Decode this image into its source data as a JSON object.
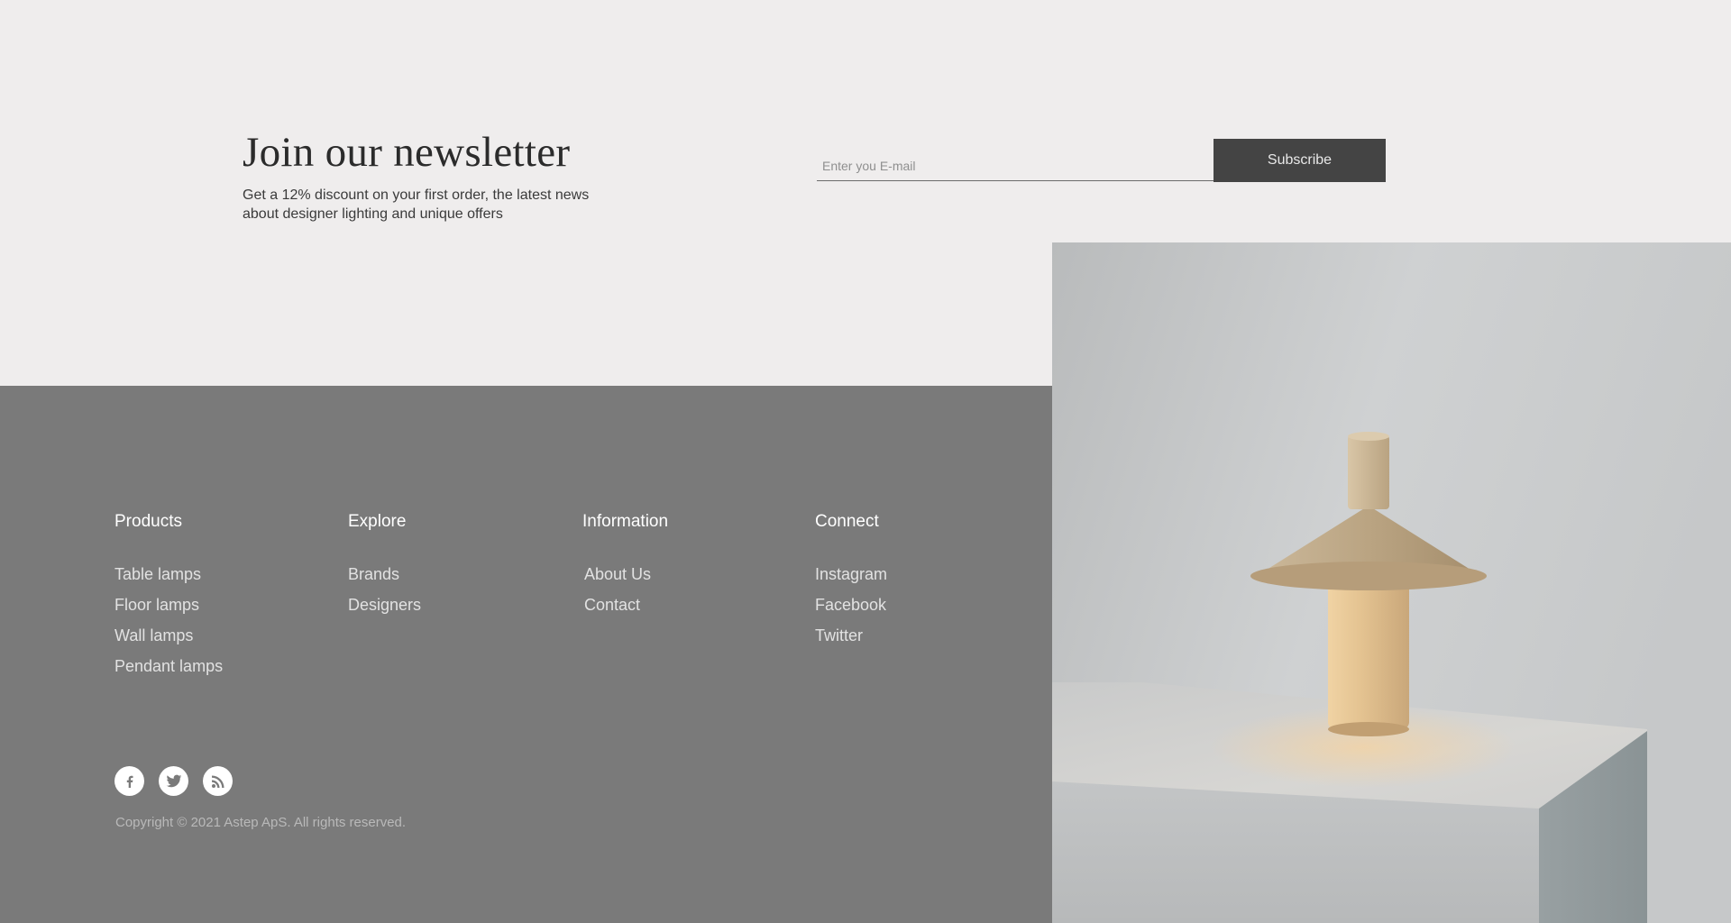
{
  "newsletter": {
    "title": "Join our newsletter",
    "description": "Get a 12% discount on your first order, the latest news about designer lighting and unique offers",
    "email_placeholder": "Enter you E-mail",
    "subscribe_label": "Subscribe"
  },
  "footer": {
    "columns": [
      {
        "heading": "Products",
        "links": [
          "Table lamps",
          "Floor lamps",
          "Wall lamps",
          "Pendant lamps"
        ]
      },
      {
        "heading": "Explore",
        "links": [
          "Brands",
          "Designers"
        ]
      },
      {
        "heading": "Information",
        "links": [
          "About Us",
          "Contact"
        ]
      },
      {
        "heading": "Connect",
        "links": [
          "Instagram",
          "Facebook",
          "Twitter"
        ]
      }
    ],
    "social_icons": [
      "facebook-icon",
      "twitter-icon",
      "rss-icon"
    ],
    "copyright": "Copyright © 2021 Astep ApS. All rights reserved."
  },
  "colors": {
    "page_background": "#efeded",
    "footer_background": "#7a7a7a",
    "button_background": "#444444",
    "heading_text": "#2b2b2b"
  }
}
